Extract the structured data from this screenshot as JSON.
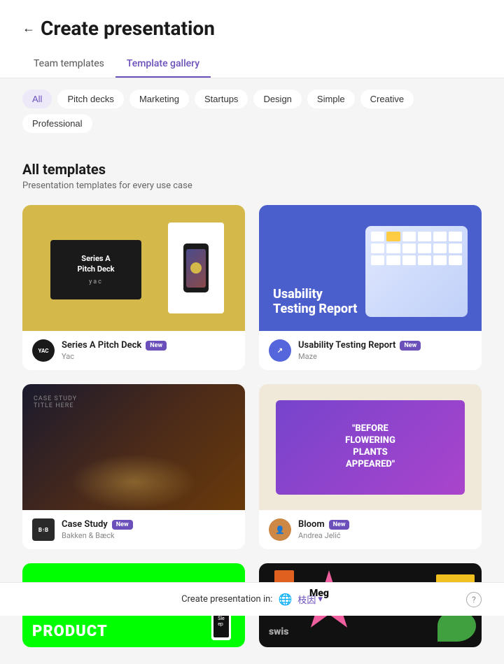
{
  "page": {
    "title": "Create presentation",
    "back_label": "←"
  },
  "tabs": [
    {
      "id": "team",
      "label": "Team templates",
      "active": false
    },
    {
      "id": "gallery",
      "label": "Template gallery",
      "active": true
    }
  ],
  "filters": [
    {
      "id": "all",
      "label": "All",
      "active": true
    },
    {
      "id": "pitch",
      "label": "Pitch decks",
      "active": false
    },
    {
      "id": "marketing",
      "label": "Marketing",
      "active": false
    },
    {
      "id": "startups",
      "label": "Startups",
      "active": false
    },
    {
      "id": "design",
      "label": "Design",
      "active": false
    },
    {
      "id": "simple",
      "label": "Simple",
      "active": false
    },
    {
      "id": "creative",
      "label": "Creative",
      "active": false
    },
    {
      "id": "professional",
      "label": "Professional",
      "active": false
    }
  ],
  "section": {
    "title": "All templates",
    "subtitle": "Presentation templates for every use case"
  },
  "templates": [
    {
      "id": "pitch-deck",
      "name": "Series A Pitch Deck",
      "badge": "New",
      "creator": "Yac",
      "avatar_text": "YAC",
      "avatar_color": "#1a1a1a",
      "thumb_type": "pitch"
    },
    {
      "id": "usability",
      "name": "Usability Testing Report",
      "badge": "New",
      "creator": "Maze",
      "avatar_text": "↗",
      "avatar_color": "#5566dd",
      "thumb_type": "usability"
    },
    {
      "id": "case-study",
      "name": "Case Study",
      "badge": "New",
      "creator": "Bakken & Bæck",
      "avatar_text": "B↑B",
      "avatar_color": "#2a2a2a",
      "thumb_type": "casestudy"
    },
    {
      "id": "bloom",
      "name": "Bloom",
      "badge": "New",
      "creator": "Andrea Jelić",
      "avatar_type": "photo",
      "avatar_color": "#cc8844",
      "thumb_type": "bloom"
    }
  ],
  "partial_templates": [
    {
      "id": "product",
      "thumb_type": "product"
    },
    {
      "id": "meg",
      "thumb_type": "meg"
    }
  ],
  "footer": {
    "label": "Create presentation in:",
    "globe_icon": "🌐",
    "language": "枝因",
    "chevron": "▾",
    "help_icon": "?"
  }
}
